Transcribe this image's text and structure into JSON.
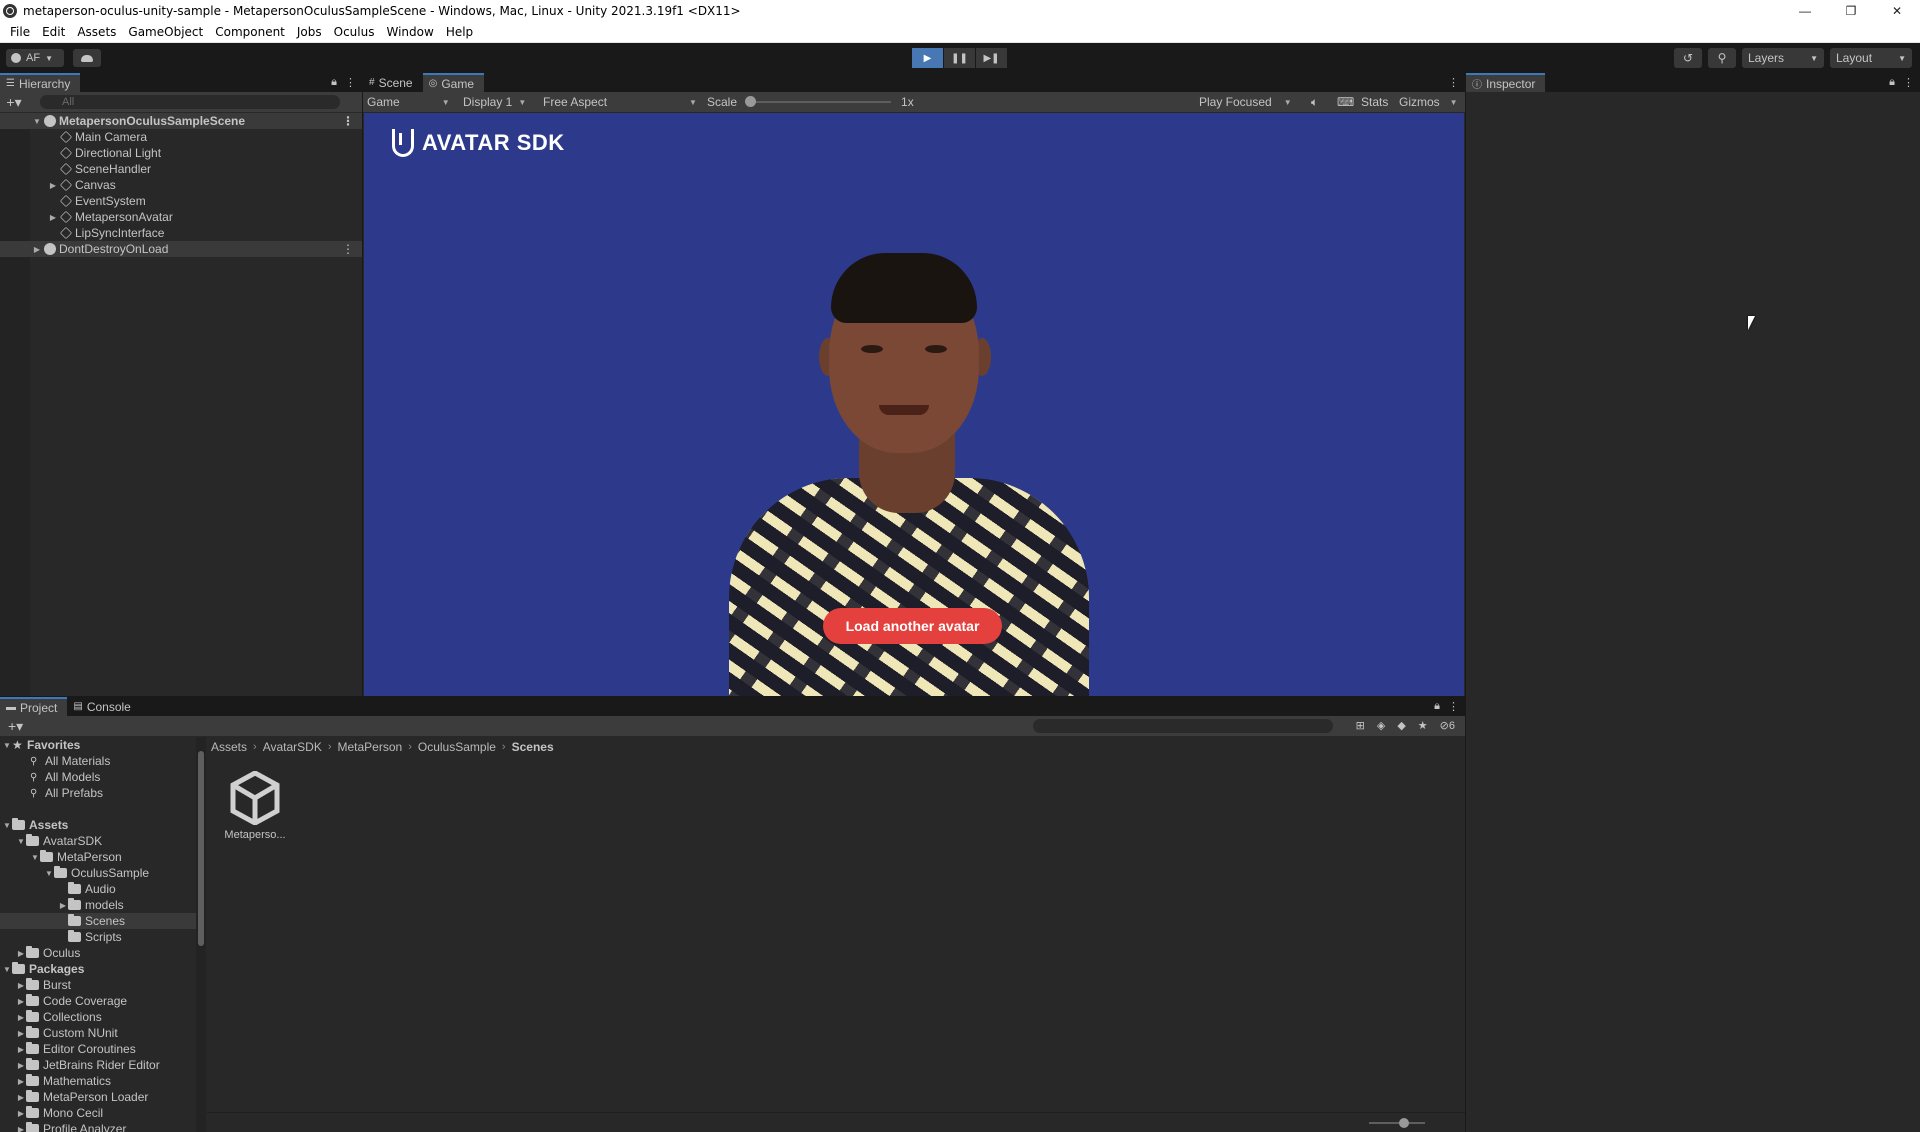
{
  "window": {
    "title": "metaperson-oculus-unity-sample - MetapersonOculusSampleScene - Windows, Mac, Linux - Unity 2021.3.19f1 <DX11>",
    "minimize": "—",
    "maximize": "❐",
    "close": "✕"
  },
  "menu": [
    "File",
    "Edit",
    "Assets",
    "GameObject",
    "Component",
    "Jobs",
    "Oculus",
    "Window",
    "Help"
  ],
  "toolbar": {
    "account": "AF",
    "layers": "Layers",
    "layout": "Layout"
  },
  "hierarchy": {
    "tab": "Hierarchy",
    "search_placeholder": "All",
    "scene": "MetapersonOculusSampleScene",
    "items": [
      "Main Camera",
      "Directional Light",
      "SceneHandler",
      "Canvas",
      "EventSystem",
      "MetapersonAvatar",
      "LipSyncInterface"
    ],
    "dont_destroy": "DontDestroyOnLoad"
  },
  "game": {
    "tab_scene": "Scene",
    "tab_game": "Game",
    "mode": "Game",
    "display": "Display 1",
    "aspect": "Free Aspect",
    "scale_label": "Scale",
    "scale_value": "1x",
    "play_focus": "Play Focused",
    "stats": "Stats",
    "gizmos": "Gizmos",
    "logo": "AVATAR SDK",
    "load_button": "Load another avatar",
    "background_color": "#2d3a8c",
    "button_color": "#e4413e"
  },
  "inspector": {
    "tab": "Inspector"
  },
  "project": {
    "tab_project": "Project",
    "tab_console": "Console",
    "hidden_count": "6",
    "breadcrumb": [
      "Assets",
      "AvatarSDK",
      "MetaPerson",
      "OculusSample",
      "Scenes"
    ],
    "favorites": {
      "label": "Favorites",
      "items": [
        "All Materials",
        "All Models",
        "All Prefabs"
      ]
    },
    "assets_label": "Assets",
    "avatar_sdk": "AvatarSDK",
    "metaperson": "MetaPerson",
    "oculus_sample": "OculusSample",
    "oculus_children": [
      "Audio",
      "models",
      "Scenes",
      "Scripts"
    ],
    "oculus": "Oculus",
    "packages_label": "Packages",
    "packages": [
      "Burst",
      "Code Coverage",
      "Collections",
      "Custom NUnit",
      "Editor Coroutines",
      "JetBrains Rider Editor",
      "Mathematics",
      "MetaPerson Loader",
      "Mono Cecil",
      "Profile Analyzer"
    ],
    "asset_file": "Metaperso..."
  }
}
